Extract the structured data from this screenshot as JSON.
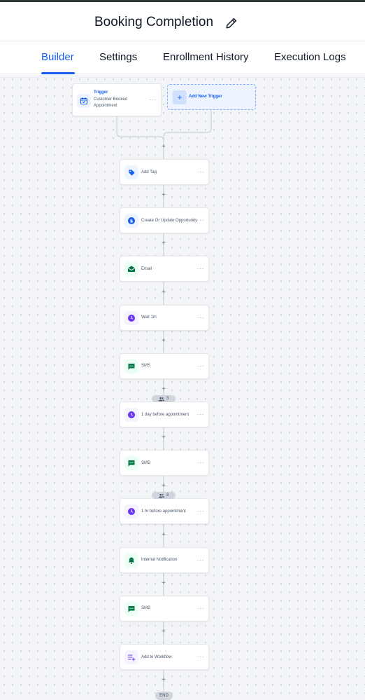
{
  "header": {
    "title": "Booking Completion",
    "edit_icon": "pencil-icon"
  },
  "tabs": [
    {
      "label": "Builder",
      "active": true
    },
    {
      "label": "Settings",
      "active": false
    },
    {
      "label": "Enrollment History",
      "active": false
    },
    {
      "label": "Execution Logs",
      "active": false
    }
  ],
  "trigger": {
    "heading": "Trigger",
    "name": "Customer Booked Appointment",
    "icon": "calendar-check-icon"
  },
  "add_trigger": {
    "label": "Add New Trigger"
  },
  "actions": [
    {
      "label": "Add Tag",
      "icon": "tag-icon",
      "color": "#155eef"
    },
    {
      "label": "Create Or Update Opportunity",
      "icon": "dollar-icon",
      "color": "#155eef"
    },
    {
      "label": "Email",
      "icon": "envelope-icon",
      "color": "#067647"
    },
    {
      "label": "Wait 1m",
      "icon": "clock-icon",
      "color": "#6938ef"
    },
    {
      "label": "SMS",
      "icon": "chat-icon",
      "color": "#067647"
    },
    {
      "label": "1 day before appointment",
      "icon": "clock-icon",
      "color": "#6938ef"
    },
    {
      "label": "SMS",
      "icon": "chat-icon",
      "color": "#067647"
    },
    {
      "label": "1 hr before appointment",
      "icon": "clock-icon",
      "color": "#6938ef"
    },
    {
      "label": "Internal Notification",
      "icon": "bell-icon",
      "color": "#067647"
    },
    {
      "label": "SMS",
      "icon": "chat-icon",
      "color": "#067647"
    },
    {
      "label": "Add to Workflow",
      "icon": "list-plus-icon",
      "color": "#6938ef"
    }
  ],
  "more_glyph": "···",
  "plus_glyph": "+",
  "count_pills": [
    {
      "count": "3"
    },
    {
      "count": "3"
    }
  ],
  "end_label": "END"
}
